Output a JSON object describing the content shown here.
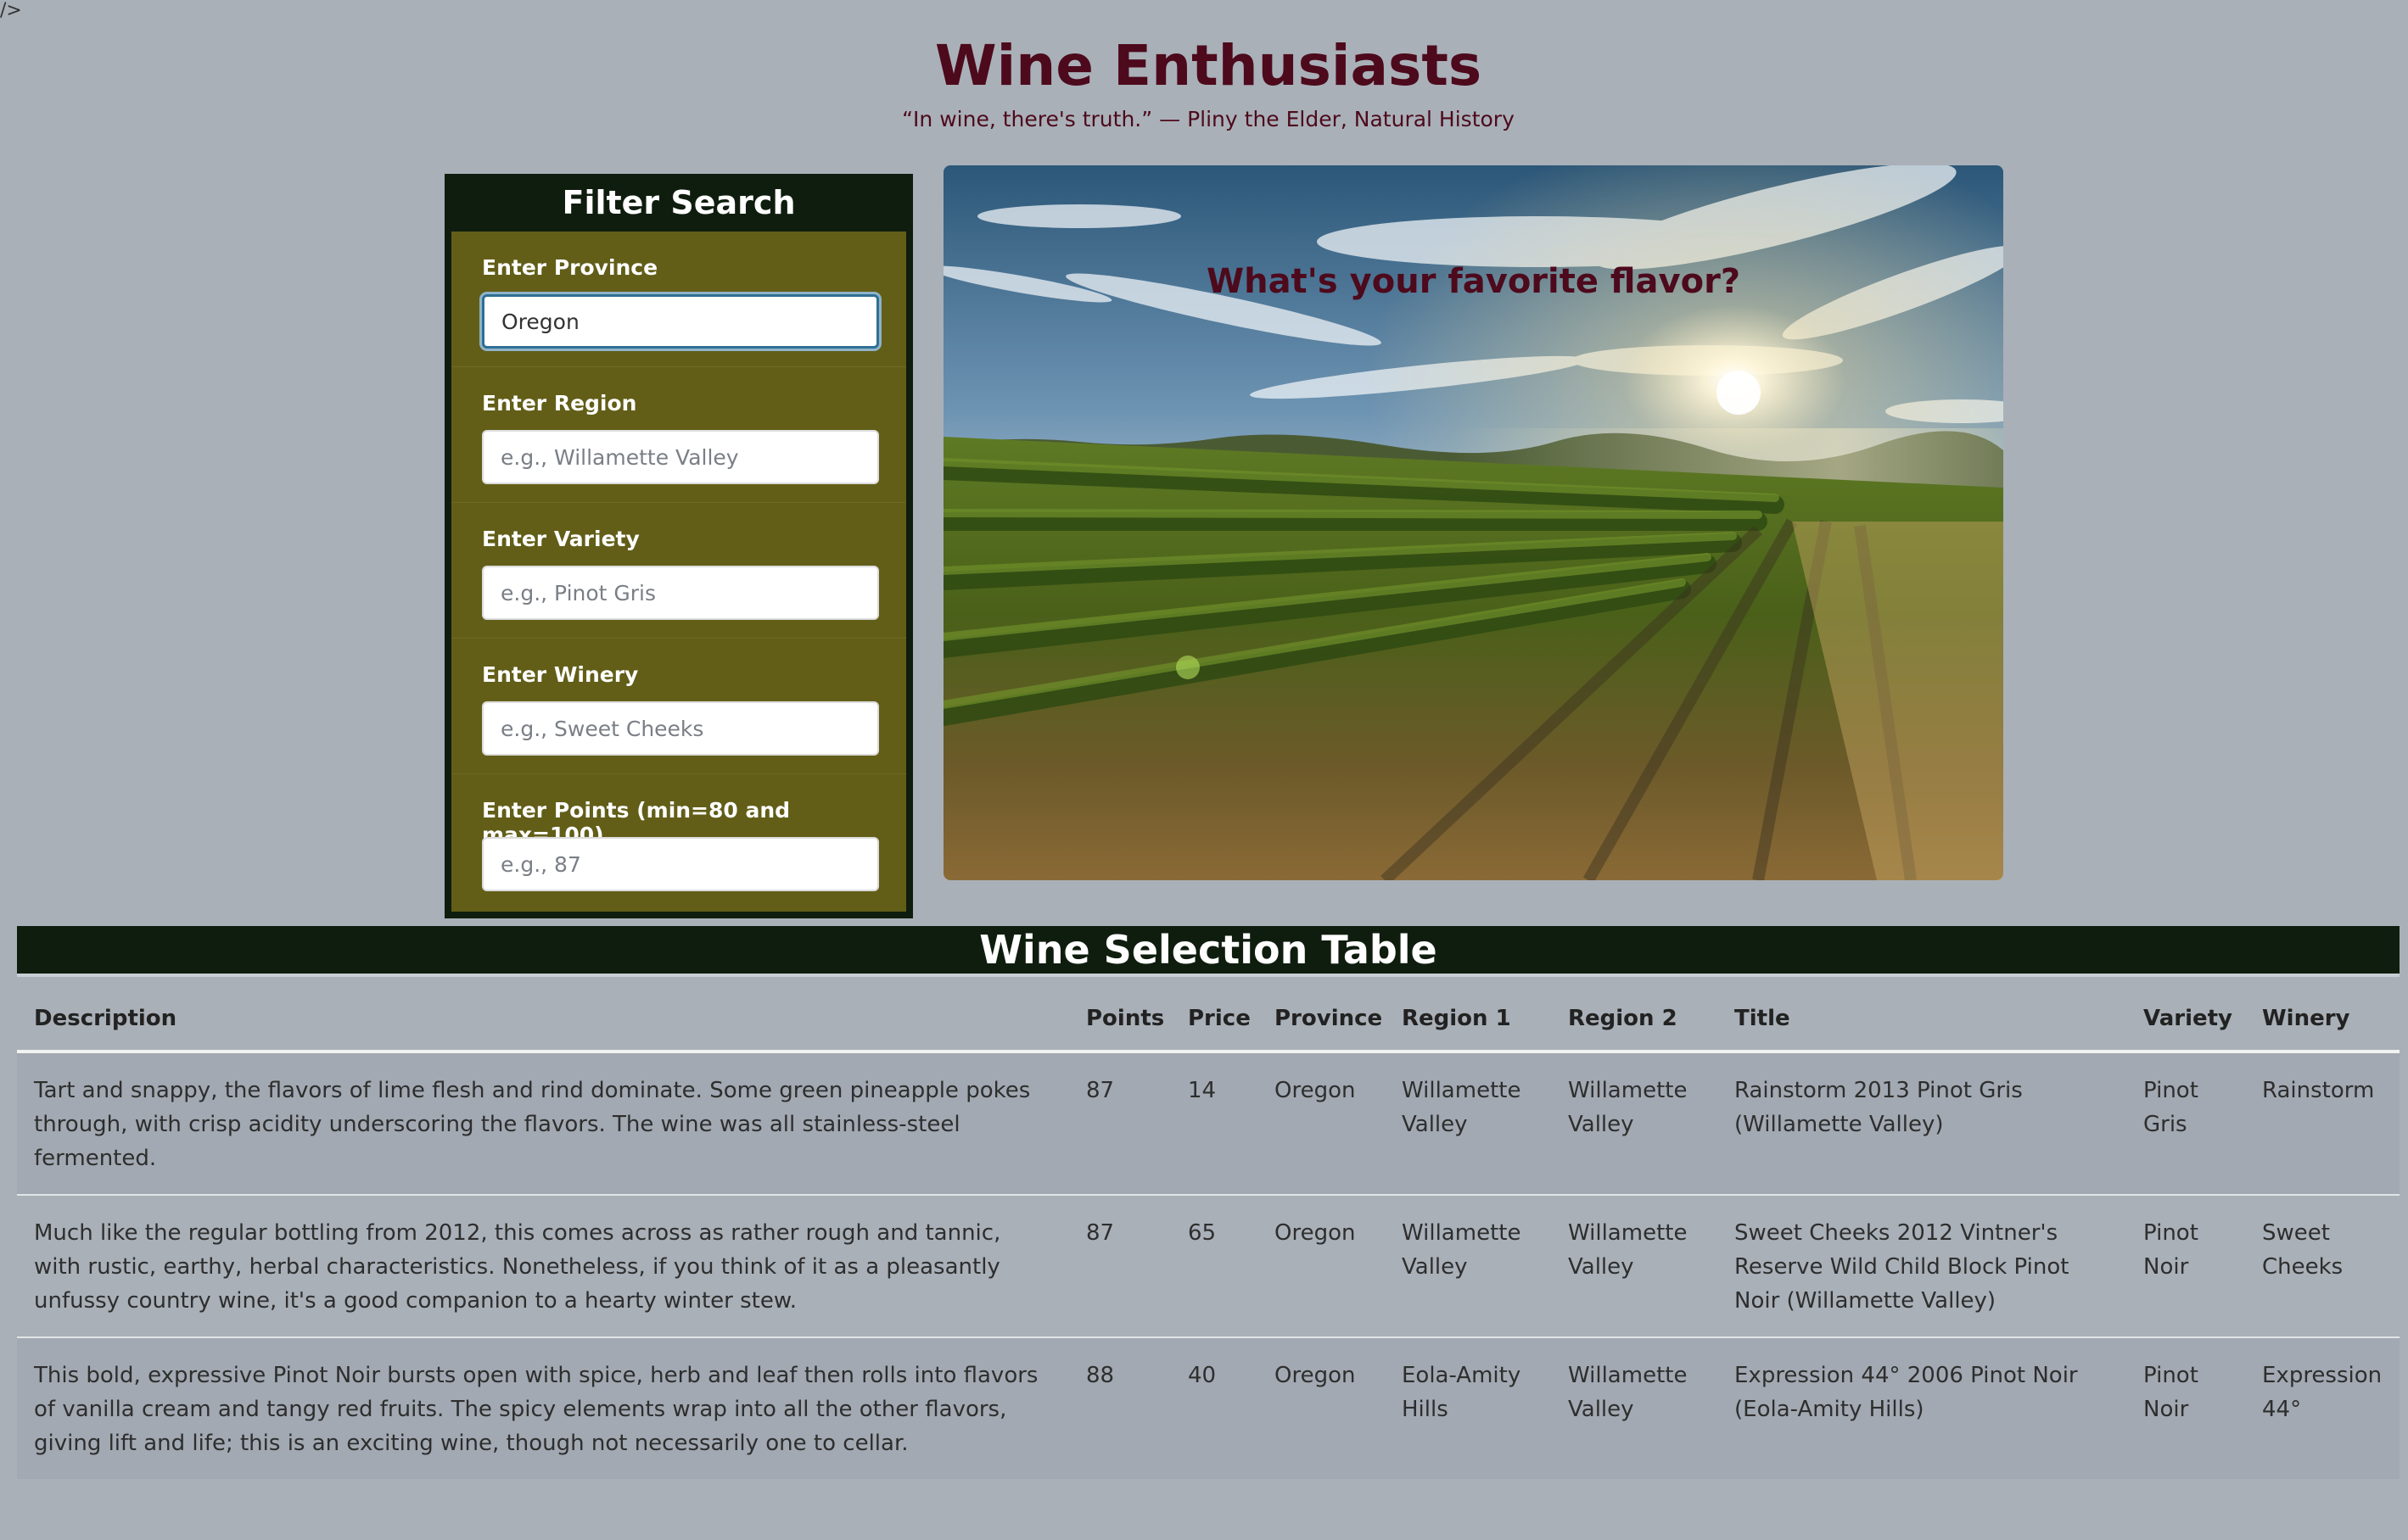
{
  "stray_text": "/>",
  "header": {
    "title": "Wine Enthusiasts",
    "quote": "“In wine, there's truth.” — Pliny the Elder, Natural History"
  },
  "filter": {
    "title": "Filter Search",
    "fields": [
      {
        "label": "Enter Province",
        "value": "Oregon",
        "placeholder": ""
      },
      {
        "label": "Enter Region",
        "value": "",
        "placeholder": "e.g., Willamette Valley"
      },
      {
        "label": "Enter Variety",
        "value": "",
        "placeholder": "e.g., Pinot Gris"
      },
      {
        "label": "Enter Winery",
        "value": "",
        "placeholder": "e.g., Sweet Cheeks"
      },
      {
        "label": "Enter Points (min=80 and max=100)",
        "value": "",
        "placeholder": "e.g., 87"
      }
    ]
  },
  "hero": {
    "caption": "What's your favorite flavor?"
  },
  "table": {
    "title": "Wine Selection Table",
    "columns": [
      "Description",
      "Points",
      "Price",
      "Province",
      "Region 1",
      "Region 2",
      "Title",
      "Variety",
      "Winery"
    ],
    "rows": [
      {
        "description": "Tart and snappy, the flavors of lime flesh and rind dominate. Some green pineapple pokes through, with crisp acidity underscoring the flavors. The wine was all stainless-steel fermented.",
        "points": "87",
        "price": "14",
        "province": "Oregon",
        "region1": "Willamette Valley",
        "region2": "Willamette Valley",
        "title": "Rainstorm 2013 Pinot Gris (Willamette Valley)",
        "variety": "Pinot Gris",
        "winery": "Rainstorm"
      },
      {
        "description": "Much like the regular bottling from 2012, this comes across as rather rough and tannic, with rustic, earthy, herbal characteristics. Nonetheless, if you think of it as a pleasantly unfussy country wine, it's a good companion to a hearty winter stew.",
        "points": "87",
        "price": "65",
        "province": "Oregon",
        "region1": "Willamette Valley",
        "region2": "Willamette Valley",
        "title": "Sweet Cheeks 2012 Vintner's Reserve Wild Child Block Pinot Noir (Willamette Valley)",
        "variety": "Pinot Noir",
        "winery": "Sweet Cheeks"
      },
      {
        "description": "This bold, expressive Pinot Noir bursts open with spice, herb and leaf then rolls into flavors of vanilla cream and tangy red fruits. The spicy elements wrap into all the other flavors, giving lift and life; this is an exciting wine, though not necessarily one to cellar.",
        "points": "88",
        "price": "40",
        "province": "Oregon",
        "region1": "Eola-Amity Hills",
        "region2": "Willamette Valley",
        "title": "Expression 44° 2006 Pinot Noir (Eola-Amity Hills)",
        "variety": "Pinot Noir",
        "winery": "Expression 44°"
      }
    ]
  },
  "colors": {
    "page_bg": "#a9b0b8",
    "title_maroon": "#4d0a1c",
    "panel_dark": "#0f1d0e",
    "panel_olive": "#625e18"
  }
}
